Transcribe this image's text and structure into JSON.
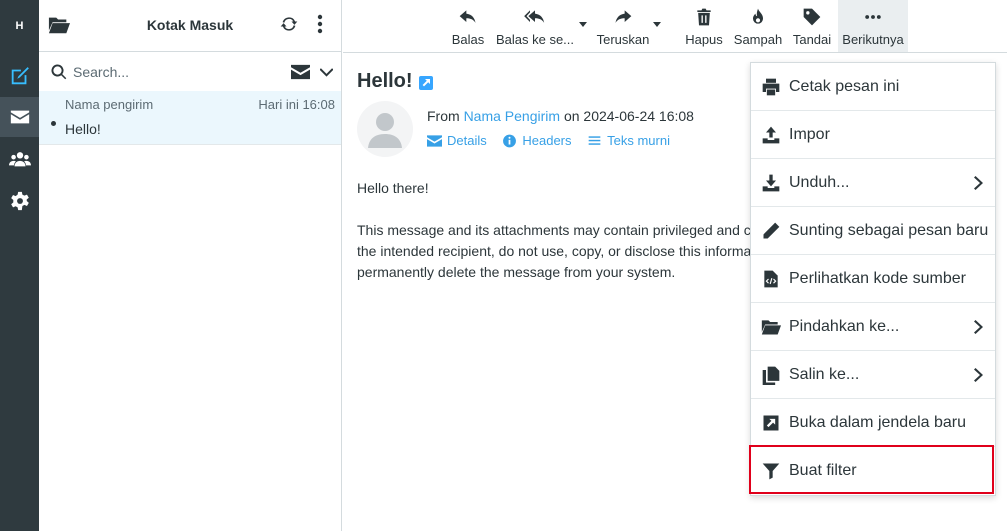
{
  "taskbar": {
    "logo": "H"
  },
  "list": {
    "title": "Kotak Masuk",
    "search_placeholder": "Search...",
    "message": {
      "sender": "Nama pengirim",
      "date": "Hari ini 16:08",
      "subject": "Hello!"
    }
  },
  "toolbar": {
    "reply": "Balas",
    "reply_all": "Balas ke se...",
    "forward": "Teruskan",
    "delete": "Hapus",
    "junk": "Sampah",
    "mark": "Tandai",
    "more": "Berikutnya"
  },
  "message": {
    "subject": "Hello!",
    "from_label": "From",
    "from_name": "Nama Pengirim",
    "on_label": "on",
    "date": "2024-06-24 16:08",
    "links": {
      "details": "Details",
      "headers": "Headers",
      "plain": "Teks murni"
    },
    "body_greeting": "Hello there!",
    "body_lines": [
      "This message and its attachments may contain privileged and c",
      "the intended recipient, do not use, copy, or disclose this informa",
      "permanently delete the message from your system."
    ]
  },
  "menu": {
    "items": [
      {
        "label": "Cetak pesan ini"
      },
      {
        "label": "Impor"
      },
      {
        "label": "Unduh..."
      },
      {
        "label": "Sunting sebagai pesan baru"
      },
      {
        "label": "Perlihatkan kode sumber"
      },
      {
        "label": "Pindahkan ke..."
      },
      {
        "label": "Salin ke..."
      },
      {
        "label": "Buka dalam jendela baru"
      },
      {
        "label": "Buat filter"
      }
    ]
  },
  "colors": {
    "link": "#37a0e6",
    "taskbar": "#2f3a3f",
    "highlight": "#e0001b",
    "selected_row": "#ebf7fd"
  }
}
